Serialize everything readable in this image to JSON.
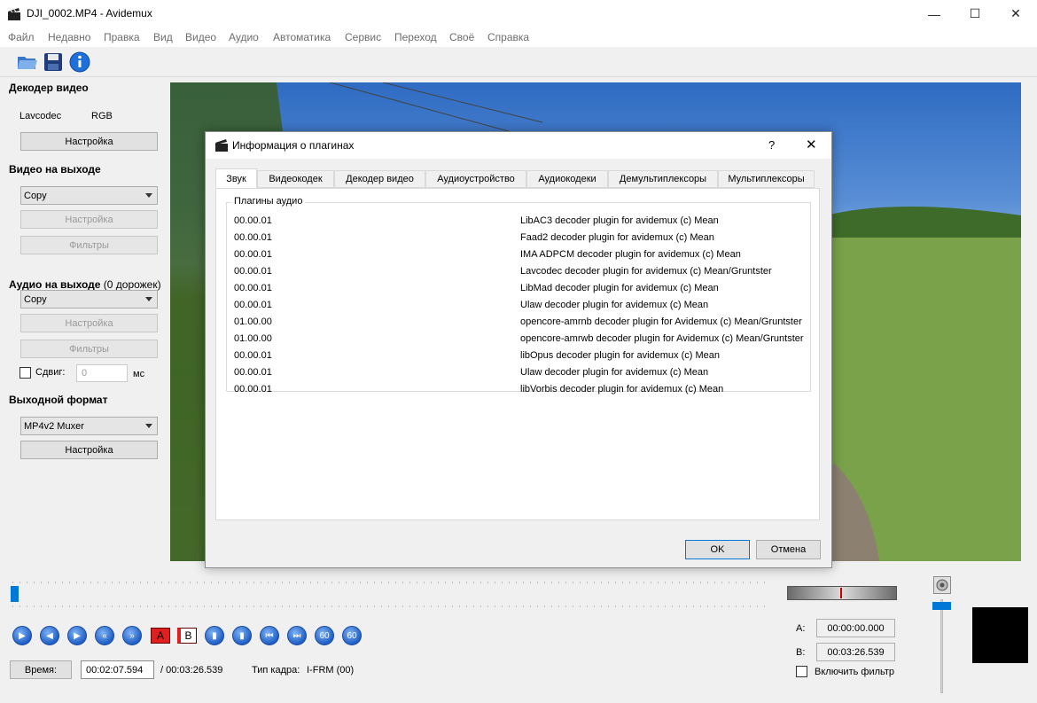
{
  "window": {
    "title": "DJI_0002.MP4 - Avidemux"
  },
  "menu": [
    "Файл",
    "Недавно",
    "Правка",
    "Вид",
    "Видео",
    "Аудио",
    "Автоматика",
    "Сервис",
    "Переход",
    "Своё",
    "Справка"
  ],
  "toolbar": {
    "icons": [
      "open-folder-icon",
      "save-icon",
      "info-icon"
    ]
  },
  "left": {
    "video_decoder": {
      "title": "Декодер видео",
      "codec": "Lavcodec",
      "format": "RGB",
      "settings": "Настройка"
    },
    "video_output": {
      "title": "Видео на выходе",
      "codec": "Copy",
      "settings": "Настройка",
      "filters": "Фильтры"
    },
    "audio_output": {
      "title": "Аудио на выходе",
      "tracks": "(0 дорожек)",
      "codec": "Copy",
      "settings": "Настройка",
      "filters": "Фильтры",
      "shift_label": "Сдвиг:",
      "shift_value": "0",
      "shift_unit": "мс"
    },
    "output_format": {
      "title": "Выходной формат",
      "muxer": "MP4v2 Muxer",
      "settings": "Настройка"
    }
  },
  "dialog": {
    "title": "Информация о плагинах",
    "help": "?",
    "tabs": [
      "Звук",
      "Видеокодек",
      "Декодер видео",
      "Аудиоустройство",
      "Аудиокодеки",
      "Демультиплексоры",
      "Мультиплексоры"
    ],
    "active_tab": "Звук",
    "group_title": "Плагины аудио",
    "plugins": [
      {
        "version": "00.00.01",
        "desc": "LibAC3 decoder plugin for avidemux (c) Mean"
      },
      {
        "version": "00.00.01",
        "desc": "Faad2 decoder plugin for avidemux (c) Mean"
      },
      {
        "version": "00.00.01",
        "desc": "IMA ADPCM decoder plugin for avidemux (c) Mean"
      },
      {
        "version": "00.00.01",
        "desc": "Lavcodec decoder plugin for avidemux (c) Mean/Gruntster"
      },
      {
        "version": "00.00.01",
        "desc": "LibMad decoder plugin for avidemux (c) Mean"
      },
      {
        "version": "00.00.01",
        "desc": "Ulaw decoder plugin for avidemux (c) Mean"
      },
      {
        "version": "01.00.00",
        "desc": "opencore-amrnb decoder plugin for Avidemux (c) Mean/Gruntster"
      },
      {
        "version": "01.00.00",
        "desc": "opencore-amrwb decoder plugin for Avidemux (c) Mean/Gruntster"
      },
      {
        "version": "00.00.01",
        "desc": "libOpus decoder plugin for avidemux (c) Mean"
      },
      {
        "version": "00.00.01",
        "desc": "Ulaw decoder plugin for avidemux (c) Mean"
      },
      {
        "version": "00.00.01",
        "desc": "libVorbis decoder plugin for avidemux (c) Mean"
      }
    ],
    "ok": "OK",
    "cancel": "Отмена"
  },
  "bottom": {
    "time_button": "Время:",
    "current_time": "00:02:07.594",
    "total_time": "/ 00:03:26.539",
    "frame_type_label": "Тип кадра:",
    "frame_type": "I-FRM (00)",
    "a_label": "A:",
    "a_value": "00:00:00.000",
    "b_label": "B:",
    "b_value": "00:03:26.539",
    "filter_checkbox": "Включить фильтр",
    "marker_a": "A",
    "marker_b": "B"
  }
}
